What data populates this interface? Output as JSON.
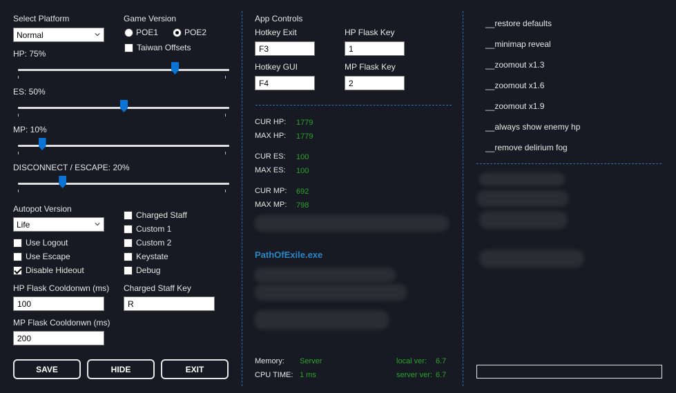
{
  "left": {
    "select_platform_label": "Select Platform",
    "platform_value": "Normal",
    "game_version_label": "Game Version",
    "poe1_label": "POE1",
    "poe2_label": "POE2",
    "selected_version": "POE2",
    "taiwan_offsets_label": "Taiwan Offsets",
    "taiwan_offsets_checked": false,
    "sliders": [
      {
        "label": "HP: 75%",
        "value": 75
      },
      {
        "label": "ES: 50%",
        "value": 50
      },
      {
        "label": "MP: 10%",
        "value": 10
      },
      {
        "label": "DISCONNECT / ESCAPE: 20%",
        "value": 20
      }
    ],
    "autopot_version_label": "Autopot Version",
    "autopot_value": "Life",
    "checks_left": [
      {
        "label": "Use Logout",
        "checked": false
      },
      {
        "label": "Use Escape",
        "checked": false
      },
      {
        "label": "Disable Hideout",
        "checked": true
      }
    ],
    "checks_right": [
      {
        "label": "Charged Staff",
        "checked": false
      },
      {
        "label": "Custom 1",
        "checked": false
      },
      {
        "label": "Custom 2",
        "checked": false
      },
      {
        "label": "Keystate",
        "checked": false
      },
      {
        "label": "Debug",
        "checked": false
      }
    ],
    "hp_cooldown_label": "HP Flask Cooldonwn (ms)",
    "hp_cooldown_value": "100",
    "mp_cooldown_label": "MP Flask Cooldonwn (ms)",
    "mp_cooldown_value": "200",
    "charged_staff_key_label": "Charged Staff Key",
    "charged_staff_key_value": "R",
    "buttons": {
      "save": "SAVE",
      "hide": "HIDE",
      "exit": "EXIT"
    }
  },
  "middle": {
    "app_controls_label": "App Controls",
    "hotkey_exit_label": "Hotkey Exit",
    "hotkey_exit_value": "F3",
    "hp_flask_key_label": "HP Flask Key",
    "hp_flask_key_value": "1",
    "hotkey_gui_label": "Hotkey GUI",
    "hotkey_gui_value": "F4",
    "mp_flask_key_label": "MP Flask Key",
    "mp_flask_key_value": "2",
    "stats": [
      {
        "label": "CUR HP:",
        "value": "1779"
      },
      {
        "label": "MAX HP:",
        "value": "1779"
      },
      {
        "label": "CUR ES:",
        "value": "100"
      },
      {
        "label": "MAX ES:",
        "value": "100"
      },
      {
        "label": "CUR MP:",
        "value": "692"
      },
      {
        "label": "MAX MP:",
        "value": "798"
      }
    ],
    "process_name": "PathOfExile.exe",
    "memory_label": "Memory:",
    "memory_value": "Server",
    "cpu_label": "CPU TIME:",
    "cpu_value": "1 ms",
    "local_ver_label": "local ver:",
    "local_ver_value": "6.7",
    "server_ver_label": "server ver:",
    "server_ver_value": "6.7"
  },
  "right": {
    "items": [
      "__restore defaults",
      "__minimap reveal",
      "__zoomout x1.3",
      "__zoomout x1.6",
      "__zoomout x1.9",
      "__always show enemy hp",
      "__remove delirium fog"
    ],
    "bottom_input_value": ""
  },
  "colors": {
    "background": "#171a22",
    "accent_blue": "#0a74d6",
    "divider_blue": "#2e6fb3",
    "stat_green": "#2aa52a",
    "process_blue": "#2b86c5"
  }
}
